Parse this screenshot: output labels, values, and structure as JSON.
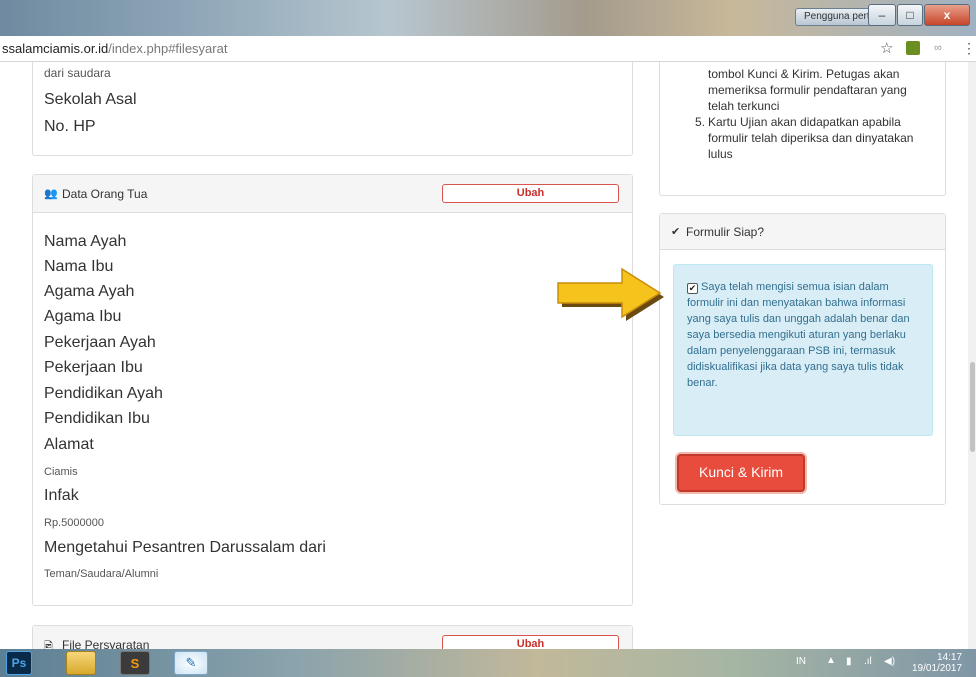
{
  "window": {
    "profile_button": "Pengguna perta...",
    "min": "–",
    "max": "□",
    "close": "x"
  },
  "address": {
    "host": "ssalamciamis.or.id",
    "path": "/index.php#filesyarat"
  },
  "left_top": {
    "line1": "dari saudara",
    "line2": "Sekolah Asal",
    "line3": "No. HP"
  },
  "orang_tua": {
    "title": "Data Orang Tua",
    "edit": "Ubah",
    "fields": {
      "nama_ayah": "Nama Ayah",
      "nama_ibu": "Nama Ibu",
      "agama_ayah": "Agama Ayah",
      "agama_ibu": "Agama Ibu",
      "pekerjaan_ayah": "Pekerjaan Ayah",
      "pekerjaan_ibu": "Pekerjaan Ibu",
      "pendidikan_ayah": "Pendidikan Ayah",
      "pendidikan_ibu": "Pendidikan Ibu",
      "alamat": "Alamat",
      "alamat_value": "Ciamis",
      "infak": "Infak",
      "infak_value": "Rp.5000000",
      "mengetahui": "Mengetahui Pesantren Darussalam dari",
      "mengetahui_value": "Teman/Saudara/Alumni"
    }
  },
  "file_persyaratan": {
    "title": "File Persyaratan",
    "edit": "Ubah"
  },
  "instructions": {
    "l1": "tombol Kunci & Kirim. Petugas akan",
    "l2": "memeriksa formulir pendaftaran yang",
    "l3": "telah terkunci",
    "num5": "5.",
    "l4": "Kartu Ujian akan didapatkan apabila",
    "l5": "formulir telah diperiksa dan dinyatakan",
    "l6": "lulus"
  },
  "formulir": {
    "title": "Formulir Siap?",
    "check_mark": "✔",
    "agreement": "Saya telah mengisi semua isian dalam formulir ini dan menyatakan bahwa informasi yang saya tulis dan unggah adalah benar dan saya bersedia mengikuti aturan yang berlaku dalam penyelenggaraan PSB ini, termasuk didiskualifikasi jika data yang saya tulis tidak benar.",
    "submit": "Kunci & Kirim"
  },
  "taskbar": {
    "ps": "Ps",
    "sublime": "S",
    "lang": "IN",
    "time": "14:17",
    "date": "19/01/2017"
  }
}
